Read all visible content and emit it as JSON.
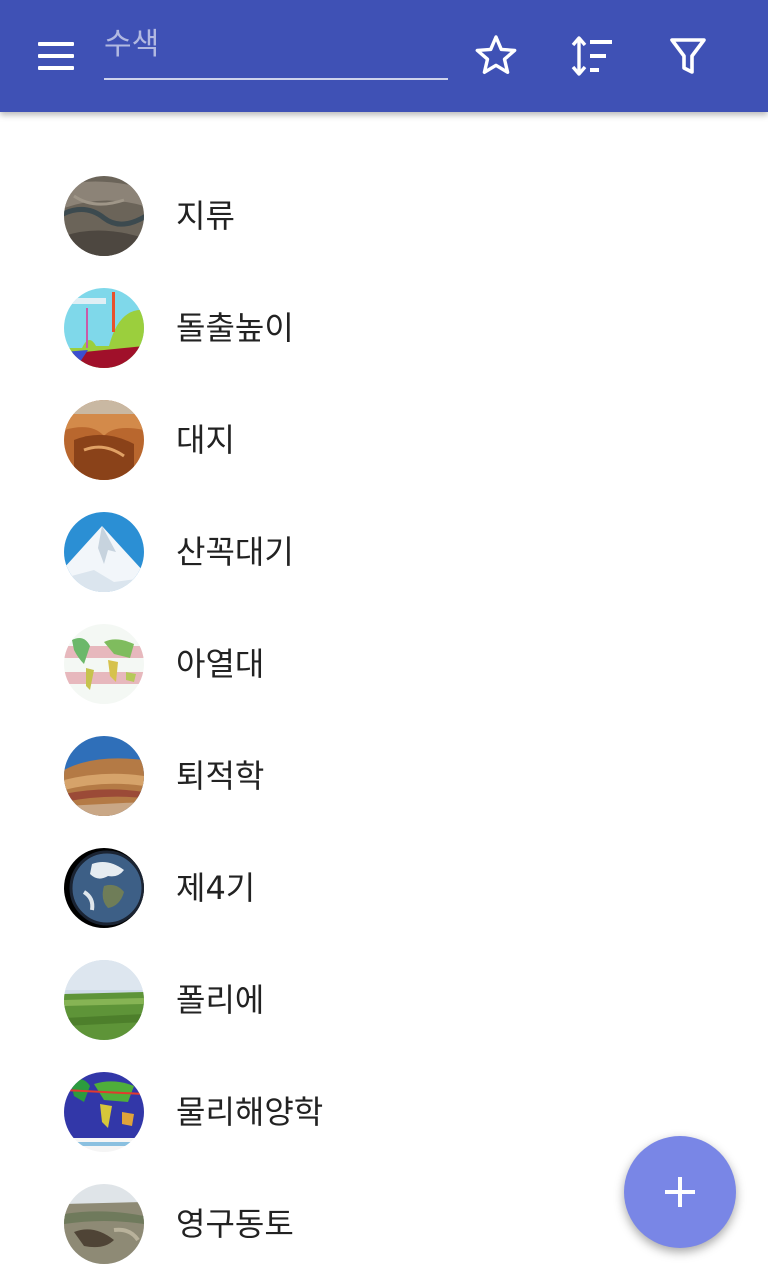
{
  "appbar": {
    "color": "#3F51B5",
    "menu_icon": "menu-icon",
    "search": {
      "placeholder": "수색",
      "value": ""
    },
    "actions": [
      "star-outline-icon",
      "sort-icon",
      "filter-icon"
    ]
  },
  "list": {
    "items": [
      {
        "label": "지류",
        "thumb": "canyon-river-aerial"
      },
      {
        "label": "돌출높이",
        "thumb": "prominence-diagram"
      },
      {
        "label": "대지",
        "thumb": "plateau-canyon"
      },
      {
        "label": "산꼭대기",
        "thumb": "snowy-peak"
      },
      {
        "label": "아열대",
        "thumb": "world-map-subtropics"
      },
      {
        "label": "퇴적학",
        "thumb": "sediment-layers"
      },
      {
        "label": "제4기",
        "thumb": "earth-globe"
      },
      {
        "label": "폴리에",
        "thumb": "green-field"
      },
      {
        "label": "물리해양학",
        "thumb": "ocean-temperature-map"
      },
      {
        "label": "영구동토",
        "thumb": "permafrost-landscape"
      }
    ]
  },
  "fab": {
    "icon": "plus-icon",
    "color": "#7986E6"
  }
}
